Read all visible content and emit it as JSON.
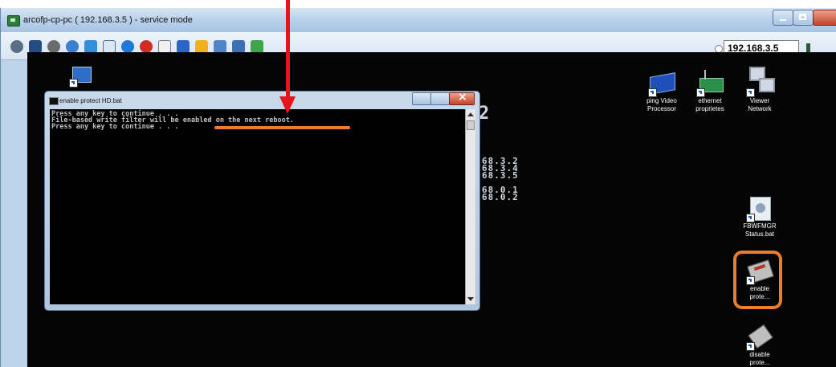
{
  "window": {
    "title": "arcofp-cp-pc ( 192.168.3.5 ) - service mode"
  },
  "toolbar": {
    "icons": [
      "settings-gear-icon",
      "fullscreen-icon",
      "cog-icon",
      "refresh-icon",
      "windows-icon",
      "monitor-icon",
      "info-icon",
      "stop-icon",
      "file-close-icon",
      "display-icon",
      "folder-icon",
      "network-icon",
      "monitor-settings-icon",
      "chat-icon"
    ],
    "ip_value": "192.168.3.5"
  },
  "desktop": {
    "background_text": {
      "top": "2",
      "lines": [
        "68.3.2",
        "68.3.4",
        "68.3.5",
        "",
        "68.0.1",
        "68.0.2"
      ]
    },
    "icons": [
      {
        "label_1": "ping Video",
        "label_2": "Processor"
      },
      {
        "label_1": "ethernet",
        "label_2": "proprietes"
      },
      {
        "label_1": "Viewer",
        "label_2": "Network"
      },
      {
        "label_1": "FBWFMGR",
        "label_2": "Status.bat"
      },
      {
        "label_1": "enable",
        "label_2": "prote..."
      },
      {
        "label_1": "disable",
        "label_2": "prote..."
      }
    ]
  },
  "console": {
    "title": "enable protect HD.bat",
    "lines": [
      "Press any key to continue . . .",
      "File-based write filter will be enabled on the next reboot.",
      "Press any key to continue . . ."
    ]
  },
  "colors": {
    "annotation_arrow": "#e8141b",
    "annotation_highlight": "#ee7d2b"
  }
}
